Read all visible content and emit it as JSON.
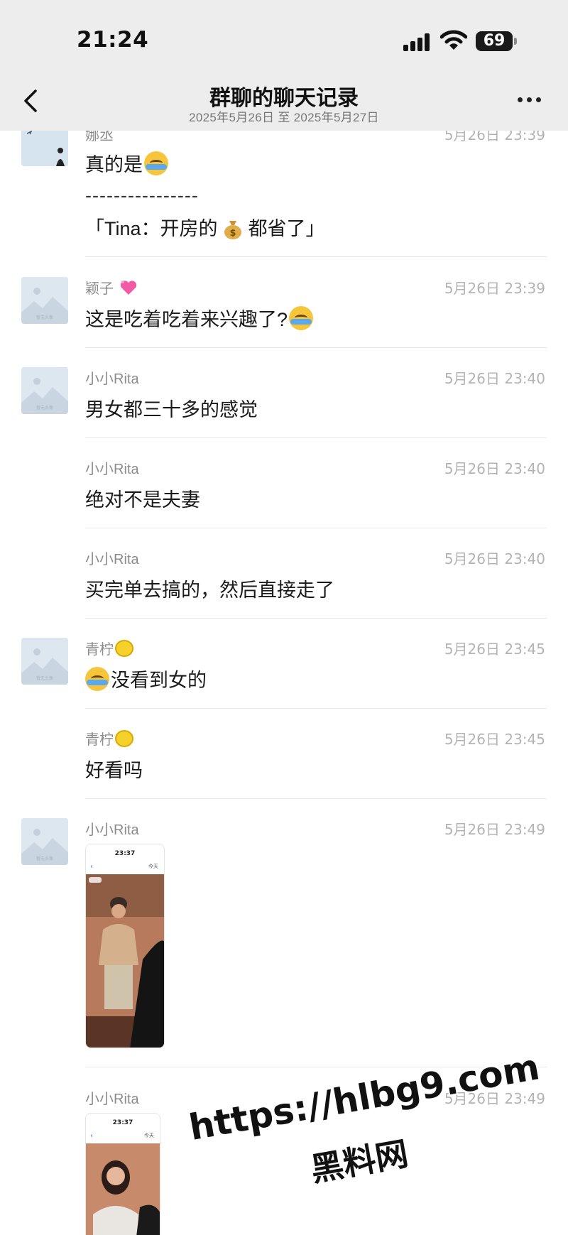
{
  "status_bar": {
    "time": "21:24",
    "battery": "69"
  },
  "nav": {
    "title": "群聊的聊天记录",
    "subtitle": "2025年5月26日 至 2025年5月27日"
  },
  "messages": [
    {
      "sender": "娜丞",
      "time": "5月26日 23:39",
      "text": "真的是",
      "separator": "----------------",
      "quote": "「Tina：开房的",
      "quote_end": "都省了」"
    },
    {
      "sender": "颖子",
      "time": "5月26日 23:39",
      "text": "这是吃着吃着来兴趣了?"
    },
    {
      "sender": "小小Rita",
      "time": "5月26日 23:40",
      "text": "男女都三十多的感觉"
    },
    {
      "sender": "小小Rita",
      "time": "5月26日 23:40",
      "text": "绝对不是夫妻"
    },
    {
      "sender": "小小Rita",
      "time": "5月26日 23:40",
      "text": "买完单去搞的，然后直接走了"
    },
    {
      "sender": "青柠",
      "time": "5月26日 23:45",
      "text": "没看到女的"
    },
    {
      "sender": "青柠",
      "time": "5月26日 23:45",
      "text": "好看吗"
    },
    {
      "sender": "小小Rita",
      "time": "5月26日 23:49",
      "photo_time": "23:37",
      "photo_label": "今天"
    },
    {
      "sender": "小小Rita",
      "time": "5月26日 23:49",
      "photo_time": "23:37",
      "photo_label": "今天"
    }
  ],
  "avatar_placeholder_text": "暂无头像",
  "watermark": {
    "url": "https://hlbg9.com",
    "name": "黑料网"
  },
  "icons": {
    "back": "chevron-left-icon",
    "more": "more-dots-icon",
    "signal": "cellular-signal-icon",
    "wifi": "wifi-icon",
    "battery": "battery-icon"
  },
  "colors": {
    "header_bg": "#ededed",
    "sender": "#8c8c8c",
    "time": "#b3b3b3",
    "text": "#1a1a1a"
  }
}
